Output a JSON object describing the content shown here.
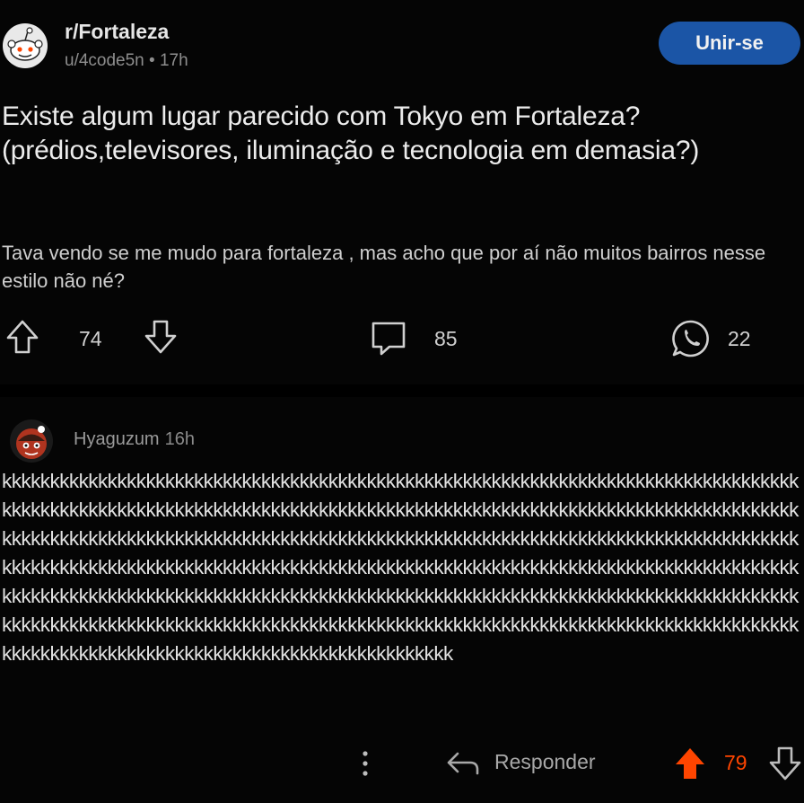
{
  "post": {
    "subreddit": "r/Fortaleza",
    "author": "u/4code5n",
    "age": "17h",
    "join_label": "Unir-se",
    "title": "Existe algum lugar parecido com Tokyo em Fortaleza? (prédios,televisores, iluminação e tecnologia em demasia?)",
    "body": "Tava vendo se me mudo para fortaleza , mas acho que por aí não muitos bairros nesse estilo não né?",
    "upvotes": "74",
    "comments": "85",
    "shares": "22"
  },
  "comment": {
    "author": "Hyaguzum",
    "age": "16h",
    "text": "kkkkkkkkkkkkkkkkkkkkkkkkkkkkkkkkkkkkkkkkkkkkkkkkkkkkkkkkkkkkkkkkkkkkkkkkkkkkkkkkkkkkkkkkkkkkkkkkkkkkkkkkkkkkkkkkkkkkkkkkkkkkkkkkkkkkkkkkkkkkkkkkkkkkkkkkkkkkkkkkkkkkkkkkkkkkkkkkkkkkkkkkkkkkkkkkkkkkkkkkkkkkkkkkkkkkkkkkkkkkkkkkkkkkkkkkkkkkkkkkkkkkkkkkkkkkkkkkkkkkkkkkkkkkkkkkkkkkkkkkkkkkkkkkkkkkkkkkkkkkkkkkkkkkkkkkkkkkkkkkkkkkkkkkkkkkkkkkkkkkkkkkkkkkkkkkkkkkkkkkkkkkkkkkkkkkkkkkkkkkkkkkkkkkkkkkkkkkkkkkkkkkkkkkkkkkkkkkkkkkkkkkkkkkkkkkkkkkkkkkkkkkkkkkkkkkkkkkkkkkkkkkkkkkkkkkkkkkkkkkkkkkkkkkkkkkkkkkkkkkkkkkkkkkkkkkkkkkkkkkkkkkkkkkkkkkkkkkkkkkkkkkk",
    "reply_label": "Responder",
    "votes": "79"
  },
  "icons": {
    "upvote": "arrow-up-outline-icon",
    "downvote": "arrow-down-outline-icon",
    "comment": "speech-bubble-icon",
    "share": "whatsapp-icon",
    "more": "vertical-dots-icon",
    "reply": "reply-arrow-icon",
    "upvoted": "arrow-up-filled-icon"
  },
  "colors": {
    "join_button": "#1b55a6",
    "upvoted": "#ff4500",
    "background": "#050505"
  }
}
